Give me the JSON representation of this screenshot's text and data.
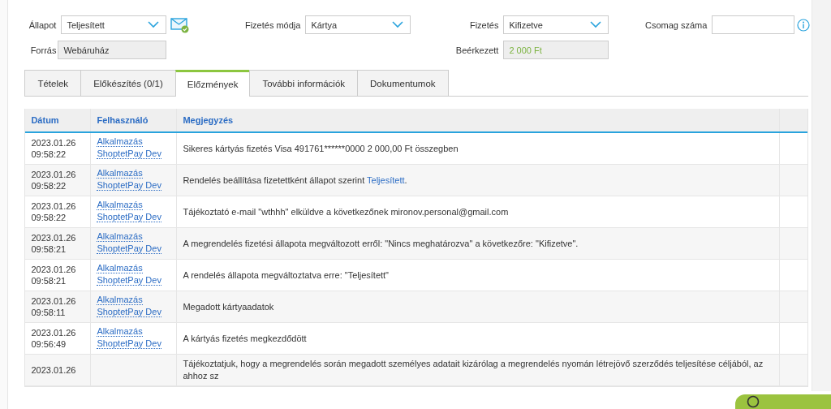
{
  "order_status": {
    "label": "Állapot",
    "value": "Teljesített"
  },
  "payment_method": {
    "label": "Fizetés módja",
    "value": "Kártya"
  },
  "payment": {
    "label": "Fizetés",
    "value": "Kifizetve"
  },
  "package_number": {
    "label": "Csomag száma"
  },
  "source": {
    "label": "Forrás",
    "value": "Webáruház",
    "readonly": true
  },
  "received": {
    "label": "Beérkezett",
    "value": "2 000 Ft",
    "readonly": true
  },
  "tabs": [
    {
      "label": "Tételek",
      "selected": false
    },
    {
      "label": "Előkészítés (0/1)",
      "selected": false
    },
    {
      "label": "Előzmények",
      "selected": true
    },
    {
      "label": "További információk",
      "selected": false
    },
    {
      "label": "Dokumentumok",
      "selected": false
    }
  ],
  "table": {
    "columns": [
      "Dátum",
      "Felhasználó",
      "Megjegyzés"
    ],
    "rows": [
      {
        "date": "2023.01.26",
        "time": "09:58:22",
        "users": [
          "Alkalmazás",
          "ShoptetPay Dev"
        ],
        "note": "Sikeres kártyás fizetés Visa 491761******0000 2 000,00 Ft összegben"
      },
      {
        "date": "2023.01.26",
        "time": "09:58:22",
        "users": [
          "Alkalmazás",
          "ShoptetPay Dev"
        ],
        "note": "Rendelés beállítása fizetettként állapot szerint ",
        "note_link": "Teljesített",
        "note_after": "."
      },
      {
        "date": "2023.01.26",
        "time": "09:58:22",
        "users": [
          "Alkalmazás",
          "ShoptetPay Dev"
        ],
        "note": "Tájékoztató e-mail \"wthhh\" elküldve a következőnek mironov.personal@gmail.com"
      },
      {
        "date": "2023.01.26",
        "time": "09:58:21",
        "users": [
          "Alkalmazás",
          "ShoptetPay Dev"
        ],
        "note": "A megrendelés fizetési állapota megváltozott erről: \"Nincs meghatározva\" a következőre: \"Kifizetve\"."
      },
      {
        "date": "2023.01.26",
        "time": "09:58:21",
        "users": [
          "Alkalmazás",
          "ShoptetPay Dev"
        ],
        "note": "A rendelés állapota megváltoztatva erre: \"Teljesített\""
      },
      {
        "date": "2023.01.26",
        "time": "09:58:11",
        "users": [
          "Alkalmazás",
          "ShoptetPay Dev"
        ],
        "note": "Megadott kártyaadatok"
      },
      {
        "date": "2023.01.26",
        "time": "09:56:49",
        "users": [
          "Alkalmazás",
          "ShoptetPay Dev"
        ],
        "note": "A kártyás fizetés megkezdődött"
      },
      {
        "date": "2023.01.26",
        "note": "Tájékoztatjuk, hogy a megrendelés során megadott személyes adatait kizárólag a megrendelés nyomán létrejövő szerződés teljesítése céljából, az ahhoz sz"
      }
    ]
  }
}
